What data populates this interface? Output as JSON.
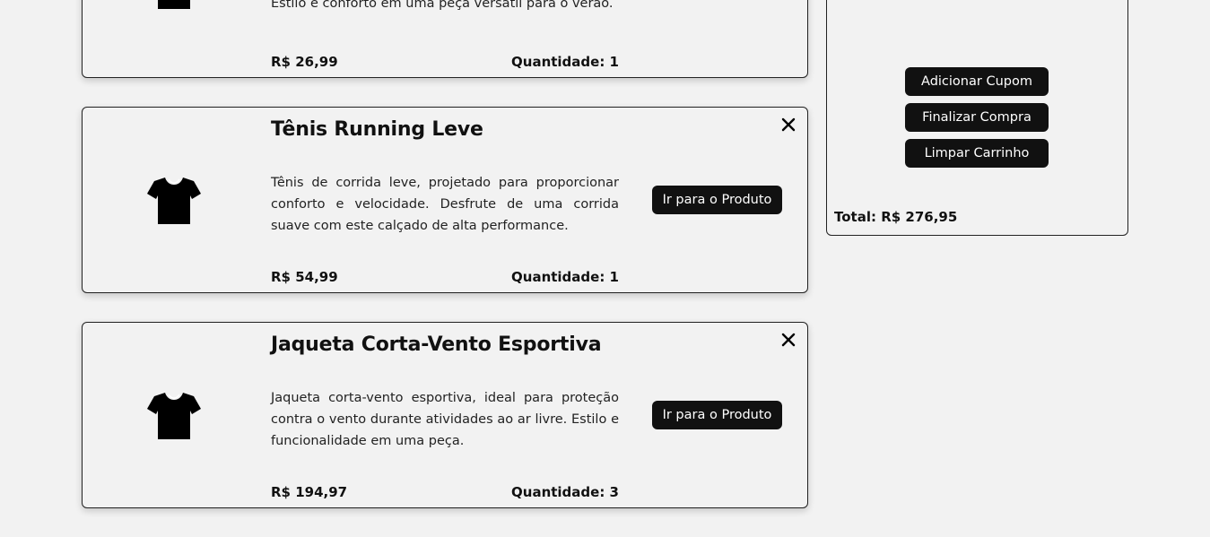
{
  "cart": {
    "items": [
      {
        "title": "",
        "description": "Estilo e conforto em uma peça versátil para o verão.",
        "price": "R$ 26,99",
        "quantity": "Quantidade: 1",
        "icon": "tshirt-icon"
      },
      {
        "title": "Tênis Running Leve",
        "description": "Tênis de corrida leve, projetado para proporcionar conforto e velocidade. Desfrute de uma corrida suave com este calçado de alta performance.",
        "price": "R$ 54,99",
        "quantity": "Quantidade: 1",
        "button": "Ir para o Produto",
        "icon": "tshirt-icon"
      },
      {
        "title": "Jaqueta Corta-Vento Esportiva",
        "description": "Jaqueta corta-vento esportiva, ideal para proteção contra o vento durante atividades ao ar livre. Estilo e funcionalidade em uma peça.",
        "price": "R$ 194,97",
        "quantity": "Quantidade: 3",
        "button": "Ir para o Produto",
        "icon": "tshirt-icon"
      }
    ]
  },
  "summary": {
    "add_coupon": "Adicionar Cupom",
    "checkout": "Finalizar Compra",
    "clear_cart": "Limpar Carrinho",
    "total": "Total: R$ 276,95"
  },
  "colors": {
    "background": "#f2f2f2",
    "button": "#111111",
    "button_text": "#ffffff"
  }
}
